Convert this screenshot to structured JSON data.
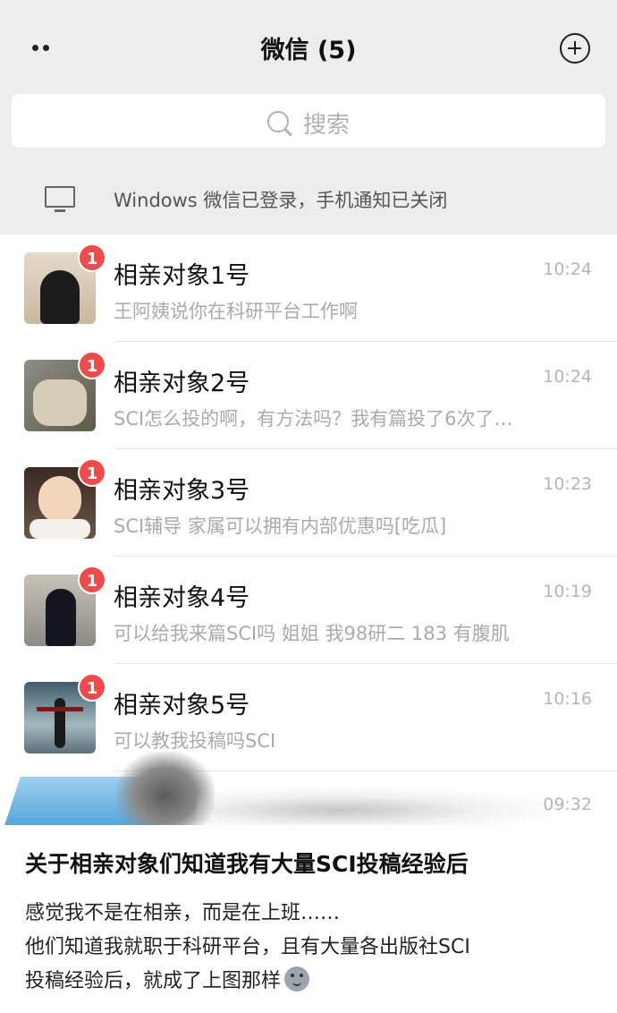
{
  "header": {
    "title": "微信 (5)",
    "search_placeholder": "搜索",
    "notice": "Windows 微信已登录，手机通知已关闭"
  },
  "chats": [
    {
      "name": "相亲对象1号",
      "preview": "王阿姨说你在科研平台工作啊",
      "time": "10:24",
      "unread": "1"
    },
    {
      "name": "相亲对象2号",
      "preview": "SCI怎么投的啊，有方法吗？我有篇投了6次了…",
      "time": "10:24",
      "unread": "1"
    },
    {
      "name": "相亲对象3号",
      "preview": "SCI辅导 家属可以拥有内部优惠吗[吃瓜]",
      "time": "10:23",
      "unread": "1"
    },
    {
      "name": "相亲对象4号",
      "preview": "可以给我来篇SCI吗 姐姐 我98研二 183 有腹肌",
      "time": "10:19",
      "unread": "1"
    },
    {
      "name": "相亲对象5号",
      "preview": "可以教我投稿吗SCI",
      "time": "10:16",
      "unread": "1"
    }
  ],
  "torn_row": {
    "time": "09:32"
  },
  "post": {
    "title": "关于相亲对象们知道我有大量SCI投稿经验后",
    "lines": [
      "感觉我不是在相亲，而是在上班……",
      "他们知道我就职于科研平台，且有大量各出版社SCI",
      "投稿经验后，就成了上图那样"
    ]
  },
  "colors": {
    "header_bg": "#ededed",
    "badge": "#f04a4a",
    "preview_text": "#aaaaaa"
  },
  "icons": [
    "more-icon",
    "add-icon",
    "search-icon",
    "monitor-icon",
    "emoji-icon"
  ]
}
